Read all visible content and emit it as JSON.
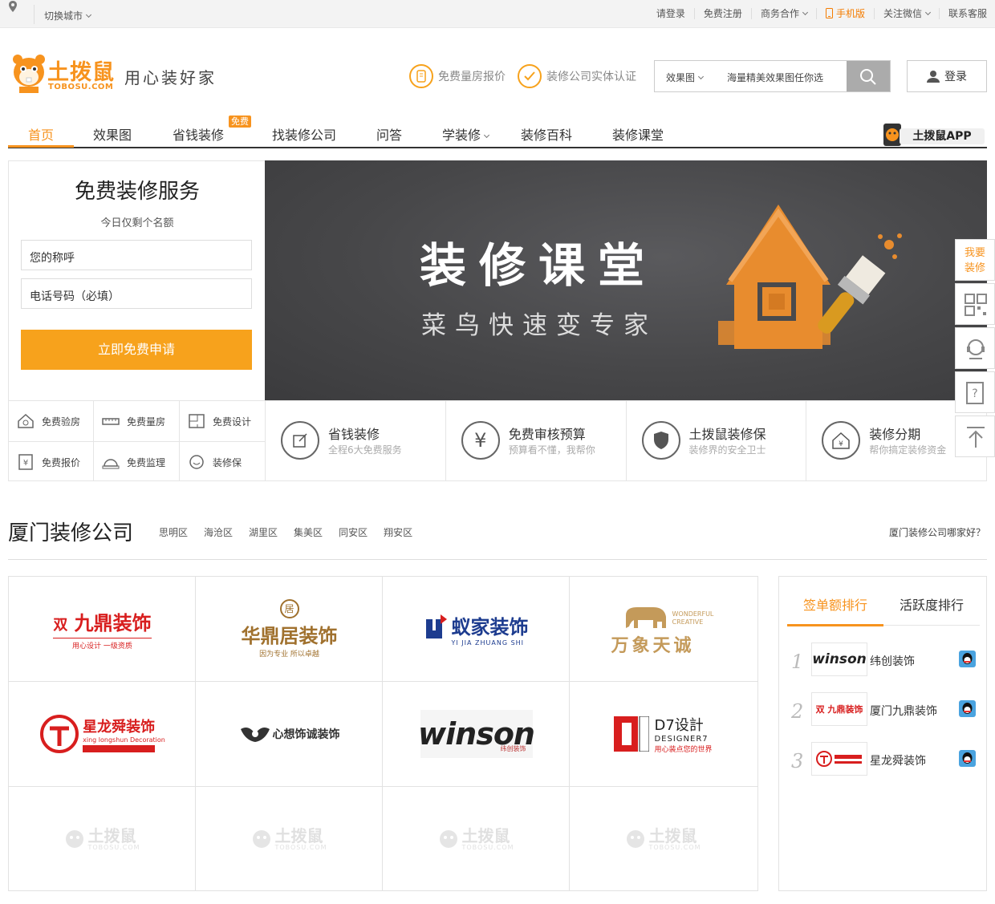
{
  "topbar": {
    "city_switch": "切换城市",
    "links": [
      "请登录",
      "免费注册",
      "商务合作",
      "手机版",
      "关注微信",
      "联系客服"
    ]
  },
  "header": {
    "logo_cn": "土拨鼠",
    "logo_en": "TOBOSU.COM",
    "slogan": "用心装好家",
    "badges": [
      "免费量房报价",
      "装修公司实体认证"
    ],
    "search": {
      "category": "效果图",
      "placeholder": "海量精美效果图任你选"
    },
    "login": "登录"
  },
  "nav": {
    "items": [
      "首页",
      "效果图",
      "省钱装修",
      "找装修公司",
      "问答",
      "学装修",
      "装修百科",
      "装修课堂"
    ],
    "free_tag": "免费",
    "app": "土拨鼠APP"
  },
  "form": {
    "title": "免费装修服务",
    "subtitle": "今日仅剩个名额",
    "name_field": "您的称呼",
    "phone_field": "电话号码（必填）",
    "submit": "立即免费申请"
  },
  "banner": {
    "title": "装修课堂",
    "subtitle": "菜鸟快速变专家"
  },
  "services": [
    "免费验房",
    "免费量房",
    "免费设计",
    "免费报价",
    "免费监理",
    "装修保"
  ],
  "features": [
    {
      "title": "省钱装修",
      "desc": "全程6大免费服务"
    },
    {
      "title": "免费审核预算",
      "desc": "预算看不懂，我帮你"
    },
    {
      "title": "土拨鼠装修保",
      "desc": "装修界的安全卫士"
    },
    {
      "title": "装修分期",
      "desc": "帮你搞定装修资金"
    }
  ],
  "float_bar": {
    "want": "我要装修"
  },
  "companies": {
    "title": "厦门装修公司",
    "districts": [
      "思明区",
      "海沧区",
      "湖里区",
      "集美区",
      "同安区",
      "翔安区"
    ],
    "which_link": "厦门装修公司哪家好？",
    "logos": [
      {
        "name": "九鼎装饰",
        "tag": "用心设计 一级资质",
        "color": "#d81e1e"
      },
      {
        "name": "华鼎居装饰",
        "tag": "因为专业 所以卓越",
        "color": "#a0712e"
      },
      {
        "name": "蚁家装饰",
        "tag": "YI JIA ZHUANG SHI",
        "color": "#1d3c8f"
      },
      {
        "name": "万象天诚",
        "tag": "WONDERFUL CREATIVE",
        "color": "#c49a5a"
      },
      {
        "name": "星龙舜装饰",
        "tag": "xing longshun Decoration",
        "color": "#d81e1e"
      },
      {
        "name": "心想饰诚装饰",
        "tag": "",
        "color": "#333333"
      },
      {
        "name": "winson",
        "tag": "纬创装饰",
        "color": "#222222"
      },
      {
        "name": "D7设計",
        "tag": "DESIGNER7",
        "color": "#d81e1e"
      }
    ],
    "placeholder_text": "土拨鼠",
    "placeholder_en": "TOBOSU.COM"
  },
  "ranking": {
    "tabs": [
      "签单额排行",
      "活跃度排行"
    ],
    "rows": [
      {
        "rank": "1",
        "name": "纬创装饰"
      },
      {
        "rank": "2",
        "name": "厦门九鼎装饰"
      },
      {
        "rank": "3",
        "name": "星龙舜装饰"
      }
    ]
  },
  "colors": {
    "accent": "#f7931e",
    "button": "#f7a21c",
    "banner_bg": "#464648"
  }
}
